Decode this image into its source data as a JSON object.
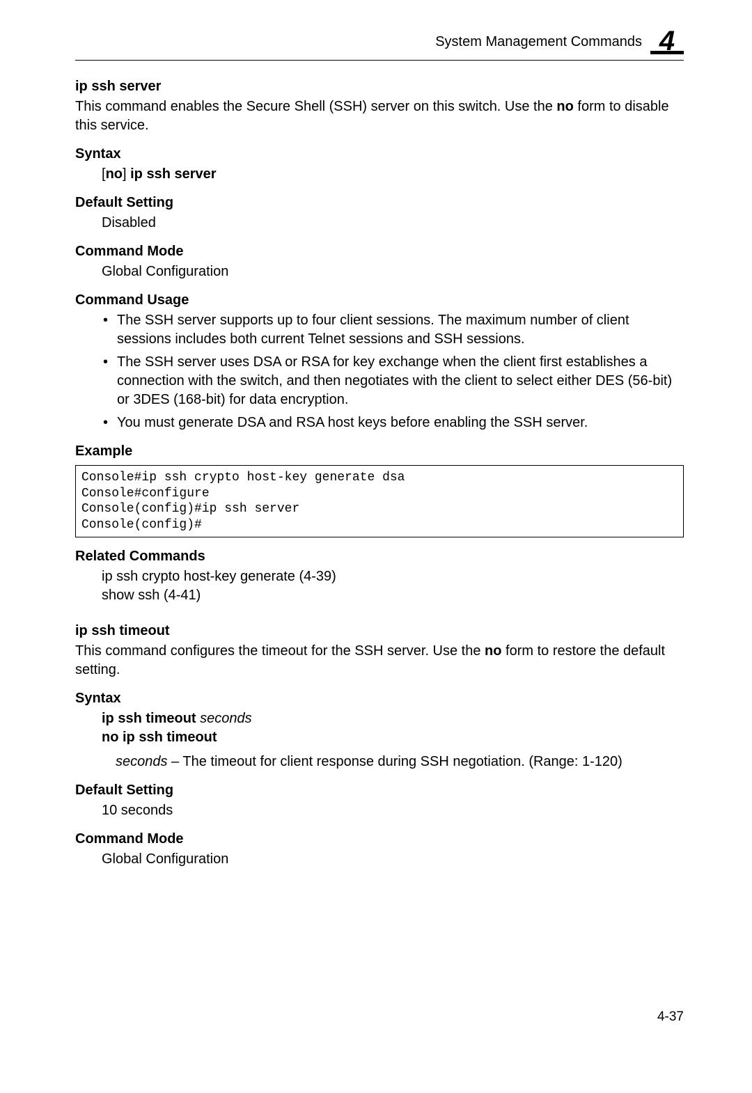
{
  "header": {
    "title": "System Management Commands",
    "chapter": "4"
  },
  "cmd1": {
    "name": "ip ssh server",
    "desc_p1": "This command enables the Secure Shell (SSH) server on this switch. Use the ",
    "desc_bold": "no",
    "desc_p2": " form to disable this service.",
    "syntax_heading": "Syntax",
    "syntax_prefix": "[",
    "syntax_no": "no",
    "syntax_bracket": "] ",
    "syntax_cmd": "ip ssh server",
    "default_heading": "Default Setting",
    "default_val": "Disabled",
    "mode_heading": "Command Mode",
    "mode_val": "Global Configuration",
    "usage_heading": "Command Usage",
    "usage": {
      "b1": "The SSH server supports up to four client sessions. The maximum number of client sessions includes both current Telnet sessions and SSH sessions.",
      "b2": "The SSH server uses DSA or RSA for key exchange when the client first establishes a connection with the switch, and then negotiates with the client to select either DES (56-bit) or 3DES (168-bit) for data encryption.",
      "b3": "You must generate DSA and RSA host keys before enabling the SSH server."
    },
    "example_heading": "Example",
    "example_code": "Console#ip ssh crypto host-key generate dsa\nConsole#configure\nConsole(config)#ip ssh server\nConsole(config)#",
    "related_heading": "Related Commands",
    "related1": "ip ssh crypto host-key generate (4-39)",
    "related2": "show ssh (4-41)"
  },
  "cmd2": {
    "name": "ip ssh timeout",
    "desc_p1": "This command configures the timeout for the SSH server. Use the ",
    "desc_bold": "no",
    "desc_p2": " form to restore the default setting.",
    "syntax_heading": "Syntax",
    "syntax_line1_cmd": "ip ssh timeout ",
    "syntax_line1_param": "seconds",
    "syntax_line2": "no ip ssh timeout",
    "param_name": "seconds",
    "param_sep": " – ",
    "param_desc": "The timeout for client response during SSH negotiation. (Range: 1-120)",
    "default_heading": "Default Setting",
    "default_val": "10 seconds",
    "mode_heading": "Command Mode",
    "mode_val": "Global Configuration"
  },
  "footer": {
    "page": "4-37"
  }
}
